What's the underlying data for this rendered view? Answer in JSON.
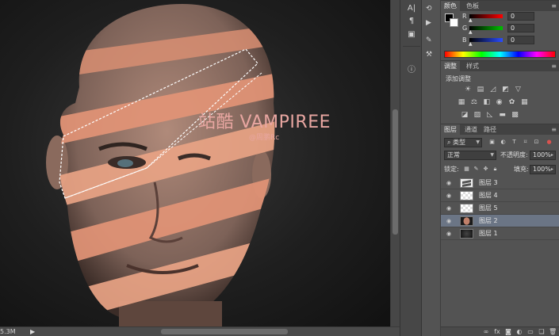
{
  "canvas": {
    "watermark_title": "站酷 VAMPIREE",
    "watermark_sub": "@周鹏Rc"
  },
  "status": {
    "zoom_text": "5.3M",
    "arrow": "▶"
  },
  "color_panel": {
    "tabs": [
      "颜色",
      "色板"
    ],
    "sliders": [
      {
        "label": "R",
        "value": "0",
        "gradient": "#ff0000"
      },
      {
        "label": "G",
        "value": "0",
        "gradient": "#00c000"
      },
      {
        "label": "B",
        "value": "0",
        "gradient": "#2a4cff"
      }
    ],
    "foreground_color": "#000000",
    "background_color": "#ffffff"
  },
  "adjustments_panel": {
    "tabs": [
      "调整",
      "样式"
    ],
    "title": "添加调整"
  },
  "layers_panel": {
    "tabs": [
      "图层",
      "通道",
      "路径"
    ],
    "filter_kind": "类型",
    "blend_mode": "正常",
    "opacity_label": "不透明度:",
    "opacity_value": "100%",
    "lock_label": "锁定:",
    "fill_label": "填充:",
    "fill_value": "100%",
    "layers": [
      {
        "name": "图层 3",
        "thumb": "mask",
        "selected": false
      },
      {
        "name": "图层 4",
        "thumb": "checker",
        "selected": false
      },
      {
        "name": "图层 5",
        "thumb": "checker",
        "selected": false
      },
      {
        "name": "图层 2",
        "thumb": "face",
        "selected": true
      },
      {
        "name": "图层 1",
        "thumb": "dark",
        "selected": false
      }
    ],
    "footer_icons": [
      "link-icon",
      "fx-icon",
      "mask-icon",
      "adjustment-icon",
      "folder-icon",
      "new-layer-icon",
      "trash-icon"
    ]
  },
  "colors": {
    "accent_selected": "#6b7585",
    "watermark": "#e8a6a1",
    "skin_stripe": "#e29476"
  }
}
